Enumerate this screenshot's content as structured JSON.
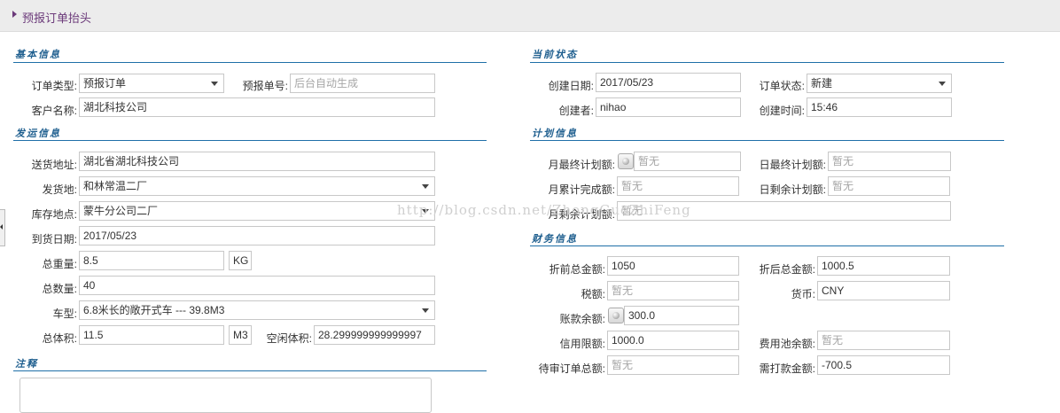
{
  "header": {
    "title": "预报订单抬头"
  },
  "sections": {
    "basic": "基本信息",
    "status": "当前状态",
    "shipping": "发运信息",
    "plan": "计划信息",
    "finance": "财务信息",
    "remark": "注释"
  },
  "basic": {
    "order_type_label": "订单类型:",
    "order_type_value": "预报订单",
    "forecast_no_label": "预报单号:",
    "forecast_no_placeholder": "后台自动生成",
    "customer_label": "客户名称:",
    "customer_value": "湖北科技公司"
  },
  "status": {
    "create_date_label": "创建日期:",
    "create_date_value": "2017/05/23",
    "order_status_label": "订单状态:",
    "order_status_value": "新建",
    "creator_label": "创建者:",
    "creator_value": "nihao",
    "create_time_label": "创建时间:",
    "create_time_value": "15:46"
  },
  "shipping": {
    "address_label": "送货地址:",
    "address_value": "湖北省湖北科技公司",
    "origin_label": "发货地:",
    "origin_value": "和林常温二厂",
    "stock_label": "库存地点:",
    "stock_value": "蒙牛分公司二厂",
    "arrival_label": "到货日期:",
    "arrival_value": "2017/05/23",
    "weight_label": "总重量:",
    "weight_value": "8.5",
    "weight_unit": "KG",
    "qty_label": "总数量:",
    "qty_value": "40",
    "vehicle_label": "车型:",
    "vehicle_value": "6.8米长的敞开式车 --- 39.8M3",
    "volume_label": "总体积:",
    "volume_value": "11.5",
    "volume_unit": "M3",
    "free_volume_label": "空闲体积:",
    "free_volume_value": "28.299999999999997"
  },
  "plan": {
    "month_final_label": "月最终计划额:",
    "month_final_value": "暂无",
    "day_final_label": "日最终计划额:",
    "day_final_value": "暂无",
    "month_done_label": "月累计完成额:",
    "month_done_value": "暂无",
    "day_remain_label": "日剩余计划额:",
    "day_remain_value": "暂无",
    "month_remain_label": "月剩余计划额:",
    "month_remain_value": "暂无"
  },
  "finance": {
    "pre_discount_label": "折前总金额:",
    "pre_discount_value": "1050",
    "post_discount_label": "折后总金额:",
    "post_discount_value": "1000.5",
    "tax_label": "税额:",
    "tax_value": "暂无",
    "currency_label": "货币:",
    "currency_value": "CNY",
    "balance_label": "账款余额:",
    "balance_value": "300.0",
    "credit_label": "信用限额:",
    "credit_value": "1000.0",
    "fee_pool_label": "费用池余额:",
    "fee_pool_value": "暂无",
    "pending_label": "待审订单总额:",
    "pending_value": "暂无",
    "payable_label": "需打款金额:",
    "payable_value": "-700.5"
  },
  "watermark": "http://blog.csdn.net/ZhongGuoZhiFeng"
}
